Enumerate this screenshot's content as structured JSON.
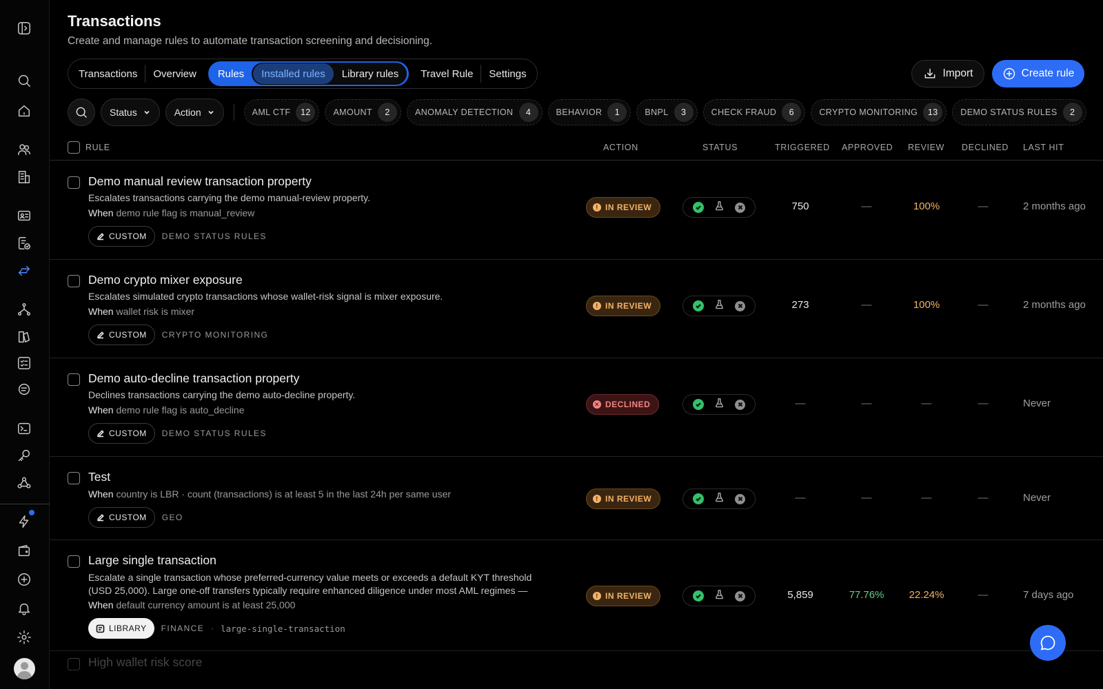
{
  "header": {
    "title": "Transactions",
    "subtitle": "Create and manage rules to automate transaction screening and decisioning."
  },
  "tabs": {
    "transactions": "Transactions",
    "overview": "Overview",
    "rules": "Rules",
    "installed_rules": "Installed rules",
    "library_rules": "Library rules",
    "travel_rule": "Travel Rule",
    "settings": "Settings"
  },
  "actions": {
    "import_label": "Import",
    "create_label": "Create rule"
  },
  "filters": {
    "status_label": "Status",
    "action_label": "Action",
    "chips": [
      {
        "label": "AML CTF",
        "count": "12"
      },
      {
        "label": "AMOUNT",
        "count": "2"
      },
      {
        "label": "ANOMALY DETECTION",
        "count": "4"
      },
      {
        "label": "BEHAVIOR",
        "count": "1"
      },
      {
        "label": "BNPL",
        "count": "3"
      },
      {
        "label": "CHECK FRAUD",
        "count": "6"
      },
      {
        "label": "CRYPTO MONITORING",
        "count": "13"
      },
      {
        "label": "DEMO STATUS RULES",
        "count": "2"
      }
    ]
  },
  "table": {
    "columns": {
      "rule": "RULE",
      "action": "ACTION",
      "status": "STATUS",
      "triggered": "TRIGGERED",
      "approved": "APPROVED",
      "review": "REVIEW",
      "declined": "DECLINED",
      "last_hit": "LAST HIT"
    },
    "rows": [
      {
        "title": "Demo manual review transaction property",
        "description": "Escalates transactions carrying the demo manual-review property.",
        "when_label": "When",
        "when": "demo rule flag is manual_review",
        "source": "CUSTOM",
        "category": "DEMO STATUS RULES",
        "action": "IN REVIEW",
        "triggered": "750",
        "approved": "—",
        "review": "100%",
        "declined": "—",
        "last_hit": "2 months ago"
      },
      {
        "title": "Demo crypto mixer exposure",
        "description": "Escalates simulated crypto transactions whose wallet-risk signal is mixer exposure.",
        "when_label": "When",
        "when": "wallet risk is mixer",
        "source": "CUSTOM",
        "category": "CRYPTO MONITORING",
        "action": "IN REVIEW",
        "triggered": "273",
        "approved": "—",
        "review": "100%",
        "declined": "—",
        "last_hit": "2 months ago"
      },
      {
        "title": "Demo auto-decline transaction property",
        "description": "Declines transactions carrying the demo auto-decline property.",
        "when_label": "When",
        "when": "demo rule flag is auto_decline",
        "source": "CUSTOM",
        "category": "DEMO STATUS RULES",
        "action": "DECLINED",
        "triggered": "—",
        "approved": "—",
        "review": "—",
        "declined": "—",
        "last_hit": "Never"
      },
      {
        "title": "Test",
        "when_label": "When",
        "when": "country is LBR · count (transactions) is at least 5 in the last 24h per same user",
        "source": "CUSTOM",
        "category": "GEO",
        "action": "IN REVIEW",
        "triggered": "—",
        "approved": "—",
        "review": "—",
        "declined": "—",
        "last_hit": "Never"
      },
      {
        "title": "Large single transaction",
        "description": "Escalate a single transaction whose preferred-currency value meets or exceeds a default KYT threshold (USD 25,000). Large one-off transfers typically require enhanced diligence under most AML regimes — review the...",
        "when_label": "When",
        "when": "default currency amount is at least 25,000",
        "source": "LIBRARY",
        "category": "FINANCE",
        "separator": "·",
        "slug": "large-single-transaction",
        "action": "IN REVIEW",
        "triggered": "5,859",
        "approved": "77.76%",
        "review": "22.24%",
        "declined": "—",
        "last_hit": "7 days ago"
      },
      {
        "title": "High wallet risk score"
      }
    ]
  },
  "colors": {
    "accent": "#2d6cf6",
    "review": "#f3b266",
    "declined": "#f08484",
    "success": "#34c26b"
  }
}
